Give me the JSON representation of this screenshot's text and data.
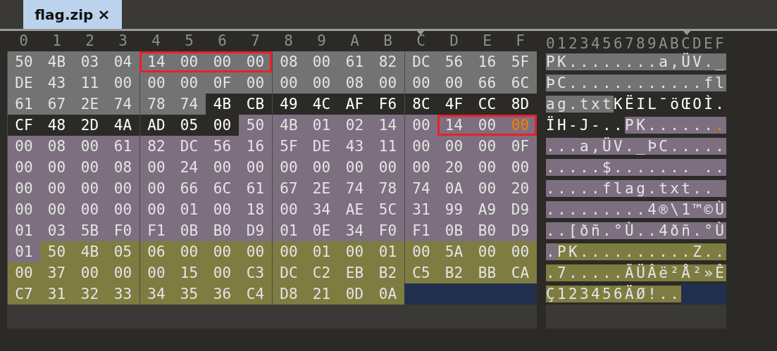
{
  "tab": {
    "title": "flag.zip",
    "close": "×",
    "selected": true
  },
  "hex_header": [
    {
      "label": "0",
      "marked": false
    },
    {
      "label": "1",
      "marked": false
    },
    {
      "label": "2",
      "marked": false
    },
    {
      "label": "3",
      "marked": false
    },
    {
      "label": "4",
      "marked": false
    },
    {
      "label": "5",
      "marked": false
    },
    {
      "label": "6",
      "marked": false
    },
    {
      "label": "7",
      "marked": false
    },
    {
      "label": "8",
      "marked": false
    },
    {
      "label": "9",
      "marked": false
    },
    {
      "label": "A",
      "marked": false
    },
    {
      "label": "B",
      "marked": false
    },
    {
      "label": "C",
      "marked": true
    },
    {
      "label": "D",
      "marked": false
    },
    {
      "label": "E",
      "marked": false
    },
    {
      "label": "F",
      "marked": false
    }
  ],
  "ascii_header": "0123456789ABCDEF",
  "rows": [
    {
      "bytes": [
        {
          "hex": "50",
          "char": "P",
          "kind": "local",
          "boxed": false,
          "selected": false
        },
        {
          "hex": "4B",
          "char": "K",
          "kind": "local",
          "boxed": false,
          "selected": false
        },
        {
          "hex": "03",
          "char": ".",
          "kind": "local",
          "boxed": false,
          "selected": false
        },
        {
          "hex": "04",
          "char": ".",
          "kind": "local",
          "boxed": false,
          "selected": false
        },
        {
          "hex": "14",
          "char": ".",
          "kind": "local",
          "boxed": true,
          "selected": false
        },
        {
          "hex": "00",
          "char": ".",
          "kind": "local",
          "boxed": true,
          "selected": false
        },
        {
          "hex": "00",
          "char": ".",
          "kind": "local",
          "boxed": true,
          "selected": false
        },
        {
          "hex": "00",
          "char": ".",
          "kind": "local",
          "boxed": true,
          "selected": false
        },
        {
          "hex": "08",
          "char": ".",
          "kind": "local",
          "boxed": false,
          "selected": false
        },
        {
          "hex": "00",
          "char": ".",
          "kind": "local",
          "boxed": false,
          "selected": false
        },
        {
          "hex": "61",
          "char": "a",
          "kind": "local",
          "boxed": false,
          "selected": false
        },
        {
          "hex": "82",
          "char": "‚",
          "kind": "local",
          "boxed": false,
          "selected": false
        },
        {
          "hex": "DC",
          "char": "Ü",
          "kind": "local",
          "boxed": false,
          "selected": false
        },
        {
          "hex": "56",
          "char": "V",
          "kind": "local",
          "boxed": false,
          "selected": false
        },
        {
          "hex": "16",
          "char": ".",
          "kind": "local",
          "boxed": false,
          "selected": false
        },
        {
          "hex": "5F",
          "char": "_",
          "kind": "local",
          "boxed": false,
          "selected": false
        }
      ]
    },
    {
      "bytes": [
        {
          "hex": "DE",
          "char": "Þ",
          "kind": "local",
          "boxed": false,
          "selected": false
        },
        {
          "hex": "43",
          "char": "C",
          "kind": "local",
          "boxed": false,
          "selected": false
        },
        {
          "hex": "11",
          "char": ".",
          "kind": "local",
          "boxed": false,
          "selected": false
        },
        {
          "hex": "00",
          "char": ".",
          "kind": "local",
          "boxed": false,
          "selected": false
        },
        {
          "hex": "00",
          "char": ".",
          "kind": "local",
          "boxed": false,
          "selected": false
        },
        {
          "hex": "00",
          "char": ".",
          "kind": "local",
          "boxed": false,
          "selected": false
        },
        {
          "hex": "0F",
          "char": ".",
          "kind": "local",
          "boxed": false,
          "selected": false
        },
        {
          "hex": "00",
          "char": ".",
          "kind": "local",
          "boxed": false,
          "selected": false
        },
        {
          "hex": "00",
          "char": ".",
          "kind": "local",
          "boxed": false,
          "selected": false
        },
        {
          "hex": "00",
          "char": ".",
          "kind": "local",
          "boxed": false,
          "selected": false
        },
        {
          "hex": "08",
          "char": ".",
          "kind": "local",
          "boxed": false,
          "selected": false
        },
        {
          "hex": "00",
          "char": ".",
          "kind": "local",
          "boxed": false,
          "selected": false
        },
        {
          "hex": "00",
          "char": ".",
          "kind": "local",
          "boxed": false,
          "selected": false
        },
        {
          "hex": "00",
          "char": ".",
          "kind": "local",
          "boxed": false,
          "selected": false
        },
        {
          "hex": "66",
          "char": "f",
          "kind": "local",
          "boxed": false,
          "selected": false
        },
        {
          "hex": "6C",
          "char": "l",
          "kind": "local",
          "boxed": false,
          "selected": false
        }
      ]
    },
    {
      "bytes": [
        {
          "hex": "61",
          "char": "a",
          "kind": "local",
          "boxed": false,
          "selected": false
        },
        {
          "hex": "67",
          "char": "g",
          "kind": "local",
          "boxed": false,
          "selected": false
        },
        {
          "hex": "2E",
          "char": ".",
          "kind": "local",
          "boxed": false,
          "selected": false
        },
        {
          "hex": "74",
          "char": "t",
          "kind": "local",
          "boxed": false,
          "selected": false
        },
        {
          "hex": "78",
          "char": "x",
          "kind": "local",
          "boxed": false,
          "selected": false
        },
        {
          "hex": "74",
          "char": "t",
          "kind": "local",
          "boxed": false,
          "selected": false
        },
        {
          "hex": "4B",
          "char": "K",
          "kind": "data",
          "boxed": false,
          "selected": false
        },
        {
          "hex": "CB",
          "char": "Ë",
          "kind": "data",
          "boxed": false,
          "selected": false
        },
        {
          "hex": "49",
          "char": "I",
          "kind": "data",
          "boxed": false,
          "selected": false
        },
        {
          "hex": "4C",
          "char": "L",
          "kind": "data",
          "boxed": false,
          "selected": false
        },
        {
          "hex": "AF",
          "char": "¯",
          "kind": "data",
          "boxed": false,
          "selected": false
        },
        {
          "hex": "F6",
          "char": "ö",
          "kind": "data",
          "boxed": false,
          "selected": false
        },
        {
          "hex": "8C",
          "char": "Œ",
          "kind": "data",
          "boxed": false,
          "selected": false
        },
        {
          "hex": "4F",
          "char": "O",
          "kind": "data",
          "boxed": false,
          "selected": false
        },
        {
          "hex": "CC",
          "char": "Ì",
          "kind": "data",
          "boxed": false,
          "selected": false
        },
        {
          "hex": "8D",
          "char": ".",
          "kind": "data",
          "boxed": false,
          "selected": false
        }
      ]
    },
    {
      "bytes": [
        {
          "hex": "CF",
          "char": "Ï",
          "kind": "data",
          "boxed": false,
          "selected": false
        },
        {
          "hex": "48",
          "char": "H",
          "kind": "data",
          "boxed": false,
          "selected": false
        },
        {
          "hex": "2D",
          "char": "-",
          "kind": "data",
          "boxed": false,
          "selected": false
        },
        {
          "hex": "4A",
          "char": "J",
          "kind": "data",
          "boxed": false,
          "selected": false
        },
        {
          "hex": "AD",
          "char": "-",
          "kind": "data",
          "boxed": false,
          "selected": false
        },
        {
          "hex": "05",
          "char": ".",
          "kind": "data",
          "boxed": false,
          "selected": false
        },
        {
          "hex": "00",
          "char": ".",
          "kind": "data",
          "boxed": false,
          "selected": false
        },
        {
          "hex": "50",
          "char": "P",
          "kind": "central",
          "boxed": false,
          "selected": false
        },
        {
          "hex": "4B",
          "char": "K",
          "kind": "central",
          "boxed": false,
          "selected": false
        },
        {
          "hex": "01",
          "char": ".",
          "kind": "central",
          "boxed": false,
          "selected": false
        },
        {
          "hex": "02",
          "char": ".",
          "kind": "central",
          "boxed": false,
          "selected": false
        },
        {
          "hex": "14",
          "char": ".",
          "kind": "central",
          "boxed": false,
          "selected": false
        },
        {
          "hex": "00",
          "char": ".",
          "kind": "central",
          "boxed": false,
          "selected": false
        },
        {
          "hex": "14",
          "char": ".",
          "kind": "central",
          "boxed": true,
          "selected": false
        },
        {
          "hex": "00",
          "char": ".",
          "kind": "central",
          "boxed": true,
          "selected": false
        },
        {
          "hex": "00",
          "char": ".",
          "kind": "central",
          "boxed": true,
          "selected": true
        }
      ]
    },
    {
      "bytes": [
        {
          "hex": "00",
          "char": ".",
          "kind": "central",
          "boxed": false,
          "selected": false
        },
        {
          "hex": "08",
          "char": ".",
          "kind": "central",
          "boxed": false,
          "selected": false
        },
        {
          "hex": "00",
          "char": ".",
          "kind": "central",
          "boxed": false,
          "selected": false
        },
        {
          "hex": "61",
          "char": "a",
          "kind": "central",
          "boxed": false,
          "selected": false
        },
        {
          "hex": "82",
          "char": "‚",
          "kind": "central",
          "boxed": false,
          "selected": false
        },
        {
          "hex": "DC",
          "char": "Ü",
          "kind": "central",
          "boxed": false,
          "selected": false
        },
        {
          "hex": "56",
          "char": "V",
          "kind": "central",
          "boxed": false,
          "selected": false
        },
        {
          "hex": "16",
          "char": ".",
          "kind": "central",
          "boxed": false,
          "selected": false
        },
        {
          "hex": "5F",
          "char": "_",
          "kind": "central",
          "boxed": false,
          "selected": false
        },
        {
          "hex": "DE",
          "char": "Þ",
          "kind": "central",
          "boxed": false,
          "selected": false
        },
        {
          "hex": "43",
          "char": "C",
          "kind": "central",
          "boxed": false,
          "selected": false
        },
        {
          "hex": "11",
          "char": ".",
          "kind": "central",
          "boxed": false,
          "selected": false
        },
        {
          "hex": "00",
          "char": ".",
          "kind": "central",
          "boxed": false,
          "selected": false
        },
        {
          "hex": "00",
          "char": ".",
          "kind": "central",
          "boxed": false,
          "selected": false
        },
        {
          "hex": "00",
          "char": ".",
          "kind": "central",
          "boxed": false,
          "selected": false
        },
        {
          "hex": "0F",
          "char": ".",
          "kind": "central",
          "boxed": false,
          "selected": false
        }
      ]
    },
    {
      "bytes": [
        {
          "hex": "00",
          "char": ".",
          "kind": "central",
          "boxed": false,
          "selected": false
        },
        {
          "hex": "00",
          "char": ".",
          "kind": "central",
          "boxed": false,
          "selected": false
        },
        {
          "hex": "00",
          "char": ".",
          "kind": "central",
          "boxed": false,
          "selected": false
        },
        {
          "hex": "08",
          "char": ".",
          "kind": "central",
          "boxed": false,
          "selected": false
        },
        {
          "hex": "00",
          "char": ".",
          "kind": "central",
          "boxed": false,
          "selected": false
        },
        {
          "hex": "24",
          "char": "$",
          "kind": "central",
          "boxed": false,
          "selected": false
        },
        {
          "hex": "00",
          "char": ".",
          "kind": "central",
          "boxed": false,
          "selected": false
        },
        {
          "hex": "00",
          "char": ".",
          "kind": "central",
          "boxed": false,
          "selected": false
        },
        {
          "hex": "00",
          "char": ".",
          "kind": "central",
          "boxed": false,
          "selected": false
        },
        {
          "hex": "00",
          "char": ".",
          "kind": "central",
          "boxed": false,
          "selected": false
        },
        {
          "hex": "00",
          "char": ".",
          "kind": "central",
          "boxed": false,
          "selected": false
        },
        {
          "hex": "00",
          "char": ".",
          "kind": "central",
          "boxed": false,
          "selected": false
        },
        {
          "hex": "00",
          "char": ".",
          "kind": "central",
          "boxed": false,
          "selected": false
        },
        {
          "hex": "20",
          "kind": "central",
          "boxed": false,
          "selected": false
        },
        {
          "hex": "00",
          "char": ".",
          "kind": "central",
          "boxed": false,
          "selected": false
        },
        {
          "hex": "00",
          "char": ".",
          "kind": "central",
          "boxed": false,
          "selected": false
        }
      ]
    },
    {
      "bytes": [
        {
          "hex": "00",
          "char": ".",
          "kind": "central",
          "boxed": false,
          "selected": false
        },
        {
          "hex": "00",
          "char": ".",
          "kind": "central",
          "boxed": false,
          "selected": false
        },
        {
          "hex": "00",
          "char": ".",
          "kind": "central",
          "boxed": false,
          "selected": false
        },
        {
          "hex": "00",
          "char": ".",
          "kind": "central",
          "boxed": false,
          "selected": false
        },
        {
          "hex": "00",
          "char": ".",
          "kind": "central",
          "boxed": false,
          "selected": false
        },
        {
          "hex": "66",
          "char": "f",
          "kind": "central",
          "boxed": false,
          "selected": false
        },
        {
          "hex": "6C",
          "char": "l",
          "kind": "central",
          "boxed": false,
          "selected": false
        },
        {
          "hex": "61",
          "char": "a",
          "kind": "central",
          "boxed": false,
          "selected": false
        },
        {
          "hex": "67",
          "char": "g",
          "kind": "central",
          "boxed": false,
          "selected": false
        },
        {
          "hex": "2E",
          "char": ".",
          "kind": "central",
          "boxed": false,
          "selected": false
        },
        {
          "hex": "74",
          "char": "t",
          "kind": "central",
          "boxed": false,
          "selected": false
        },
        {
          "hex": "78",
          "char": "x",
          "kind": "central",
          "boxed": false,
          "selected": false
        },
        {
          "hex": "74",
          "char": "t",
          "kind": "central",
          "boxed": false,
          "selected": false
        },
        {
          "hex": "0A",
          "char": ".",
          "kind": "central",
          "boxed": false,
          "selected": false
        },
        {
          "hex": "00",
          "char": ".",
          "kind": "central",
          "boxed": false,
          "selected": false
        },
        {
          "hex": "20",
          "kind": "central",
          "boxed": false,
          "selected": false
        }
      ]
    },
    {
      "bytes": [
        {
          "hex": "00",
          "char": ".",
          "kind": "central",
          "boxed": false,
          "selected": false
        },
        {
          "hex": "00",
          "char": ".",
          "kind": "central",
          "boxed": false,
          "selected": false
        },
        {
          "hex": "00",
          "char": ".",
          "kind": "central",
          "boxed": false,
          "selected": false
        },
        {
          "hex": "00",
          "char": ".",
          "kind": "central",
          "boxed": false,
          "selected": false
        },
        {
          "hex": "00",
          "char": ".",
          "kind": "central",
          "boxed": false,
          "selected": false
        },
        {
          "hex": "01",
          "char": ".",
          "kind": "central",
          "boxed": false,
          "selected": false
        },
        {
          "hex": "00",
          "char": ".",
          "kind": "central",
          "boxed": false,
          "selected": false
        },
        {
          "hex": "18",
          "char": ".",
          "kind": "central",
          "boxed": false,
          "selected": false
        },
        {
          "hex": "00",
          "char": ".",
          "kind": "central",
          "boxed": false,
          "selected": false
        },
        {
          "hex": "34",
          "char": "4",
          "kind": "central",
          "boxed": false,
          "selected": false
        },
        {
          "hex": "AE",
          "char": "®",
          "kind": "central",
          "boxed": false,
          "selected": false
        },
        {
          "hex": "5C",
          "char": "\\",
          "kind": "central",
          "boxed": false,
          "selected": false
        },
        {
          "hex": "31",
          "char": "1",
          "kind": "central",
          "boxed": false,
          "selected": false
        },
        {
          "hex": "99",
          "char": "™",
          "kind": "central",
          "boxed": false,
          "selected": false
        },
        {
          "hex": "A9",
          "char": "©",
          "kind": "central",
          "boxed": false,
          "selected": false
        },
        {
          "hex": "D9",
          "char": "Ù",
          "kind": "central",
          "boxed": false,
          "selected": false
        }
      ]
    },
    {
      "bytes": [
        {
          "hex": "01",
          "char": ".",
          "kind": "central",
          "boxed": false,
          "selected": false
        },
        {
          "hex": "03",
          "char": ".",
          "kind": "central",
          "boxed": false,
          "selected": false
        },
        {
          "hex": "5B",
          "char": "[",
          "kind": "central",
          "boxed": false,
          "selected": false
        },
        {
          "hex": "F0",
          "char": "ð",
          "kind": "central",
          "boxed": false,
          "selected": false
        },
        {
          "hex": "F1",
          "char": "ñ",
          "kind": "central",
          "boxed": false,
          "selected": false
        },
        {
          "hex": "0B",
          "char": ".",
          "kind": "central",
          "boxed": false,
          "selected": false
        },
        {
          "hex": "B0",
          "char": "°",
          "kind": "central",
          "boxed": false,
          "selected": false
        },
        {
          "hex": "D9",
          "char": "Ù",
          "kind": "central",
          "boxed": false,
          "selected": false
        },
        {
          "hex": "01",
          "char": ".",
          "kind": "central",
          "boxed": false,
          "selected": false
        },
        {
          "hex": "0E",
          "char": ".",
          "kind": "central",
          "boxed": false,
          "selected": false
        },
        {
          "hex": "34",
          "char": "4",
          "kind": "central",
          "boxed": false,
          "selected": false
        },
        {
          "hex": "F0",
          "char": "ð",
          "kind": "central",
          "boxed": false,
          "selected": false
        },
        {
          "hex": "F1",
          "char": "ñ",
          "kind": "central",
          "boxed": false,
          "selected": false
        },
        {
          "hex": "0B",
          "char": ".",
          "kind": "central",
          "boxed": false,
          "selected": false
        },
        {
          "hex": "B0",
          "char": "°",
          "kind": "central",
          "boxed": false,
          "selected": false
        },
        {
          "hex": "D9",
          "char": "Ù",
          "kind": "central",
          "boxed": false,
          "selected": false
        }
      ]
    },
    {
      "bytes": [
        {
          "hex": "01",
          "char": ".",
          "kind": "central",
          "boxed": false,
          "selected": false
        },
        {
          "hex": "50",
          "char": "P",
          "kind": "end",
          "boxed": false,
          "selected": false
        },
        {
          "hex": "4B",
          "char": "K",
          "kind": "end",
          "boxed": false,
          "selected": false
        },
        {
          "hex": "05",
          "char": ".",
          "kind": "end",
          "boxed": false,
          "selected": false
        },
        {
          "hex": "06",
          "char": ".",
          "kind": "end",
          "boxed": false,
          "selected": false
        },
        {
          "hex": "00",
          "char": ".",
          "kind": "end",
          "boxed": false,
          "selected": false
        },
        {
          "hex": "00",
          "char": ".",
          "kind": "end",
          "boxed": false,
          "selected": false
        },
        {
          "hex": "00",
          "char": ".",
          "kind": "end",
          "boxed": false,
          "selected": false
        },
        {
          "hex": "00",
          "char": ".",
          "kind": "end",
          "boxed": false,
          "selected": false
        },
        {
          "hex": "01",
          "char": ".",
          "kind": "end",
          "boxed": false,
          "selected": false
        },
        {
          "hex": "00",
          "char": ".",
          "kind": "end",
          "boxed": false,
          "selected": false
        },
        {
          "hex": "01",
          "char": ".",
          "kind": "end",
          "boxed": false,
          "selected": false
        },
        {
          "hex": "00",
          "char": ".",
          "kind": "end",
          "boxed": false,
          "selected": false
        },
        {
          "hex": "5A",
          "char": "Z",
          "kind": "end",
          "boxed": false,
          "selected": false
        },
        {
          "hex": "00",
          "char": ".",
          "kind": "end",
          "boxed": false,
          "selected": false
        },
        {
          "hex": "00",
          "char": ".",
          "kind": "end",
          "boxed": false,
          "selected": false
        }
      ]
    },
    {
      "bytes": [
        {
          "hex": "00",
          "char": ".",
          "kind": "end",
          "boxed": false,
          "selected": false
        },
        {
          "hex": "37",
          "char": "7",
          "kind": "end",
          "boxed": false,
          "selected": false
        },
        {
          "hex": "00",
          "char": ".",
          "kind": "end",
          "boxed": false,
          "selected": false
        },
        {
          "hex": "00",
          "char": ".",
          "kind": "end",
          "boxed": false,
          "selected": false
        },
        {
          "hex": "00",
          "char": ".",
          "kind": "end",
          "boxed": false,
          "selected": false
        },
        {
          "hex": "15",
          "char": ".",
          "kind": "end",
          "boxed": false,
          "selected": false
        },
        {
          "hex": "00",
          "char": ".",
          "kind": "end",
          "boxed": false,
          "selected": false
        },
        {
          "hex": "C3",
          "char": "Ã",
          "kind": "end",
          "boxed": false,
          "selected": false
        },
        {
          "hex": "DC",
          "char": "Ü",
          "kind": "end",
          "boxed": false,
          "selected": false
        },
        {
          "hex": "C2",
          "char": "Â",
          "kind": "end",
          "boxed": false,
          "selected": false
        },
        {
          "hex": "EB",
          "char": "ë",
          "kind": "end",
          "boxed": false,
          "selected": false
        },
        {
          "hex": "B2",
          "char": "²",
          "kind": "end",
          "boxed": false,
          "selected": false
        },
        {
          "hex": "C5",
          "char": "Å",
          "kind": "end",
          "boxed": false,
          "selected": false
        },
        {
          "hex": "B2",
          "char": "²",
          "kind": "end",
          "boxed": false,
          "selected": false
        },
        {
          "hex": "BB",
          "char": "»",
          "kind": "end",
          "boxed": false,
          "selected": false
        },
        {
          "hex": "CA",
          "char": "Ê",
          "kind": "end",
          "boxed": false,
          "selected": false
        }
      ]
    },
    {
      "bytes": [
        {
          "hex": "C7",
          "char": "Ç",
          "kind": "end",
          "boxed": false,
          "selected": false
        },
        {
          "hex": "31",
          "char": "1",
          "kind": "end",
          "boxed": false,
          "selected": false
        },
        {
          "hex": "32",
          "char": "2",
          "kind": "end",
          "boxed": false,
          "selected": false
        },
        {
          "hex": "33",
          "char": "3",
          "kind": "end",
          "boxed": false,
          "selected": false
        },
        {
          "hex": "34",
          "char": "4",
          "kind": "end",
          "boxed": false,
          "selected": false
        },
        {
          "hex": "35",
          "char": "5",
          "kind": "end",
          "boxed": false,
          "selected": false
        },
        {
          "hex": "36",
          "char": "6",
          "kind": "end",
          "boxed": false,
          "selected": false
        },
        {
          "hex": "C4",
          "char": "Ä",
          "kind": "end",
          "boxed": false,
          "selected": false
        },
        {
          "hex": "D8",
          "char": "Ø",
          "kind": "end",
          "boxed": false,
          "selected": false
        },
        {
          "hex": "21",
          "char": "!",
          "kind": "end",
          "boxed": false,
          "selected": false
        },
        {
          "hex": "0D",
          "char": ".",
          "kind": "end",
          "boxed": false,
          "selected": false
        },
        {
          "hex": "0A",
          "char": ".",
          "kind": "end",
          "boxed": false,
          "selected": false
        }
      ]
    }
  ]
}
